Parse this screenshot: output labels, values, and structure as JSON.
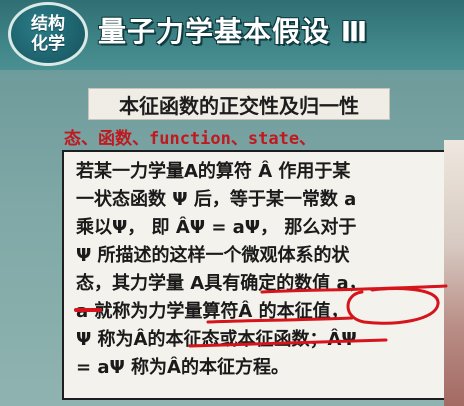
{
  "header": {
    "badge_line1": "结构",
    "badge_line2": "化学",
    "title": "量子力学基本假设 Ⅲ"
  },
  "subtitle": "本征函数的正交性及归一性",
  "annotation": "态、函数、function、state、",
  "content": {
    "line1": "若某一力学量A的算符 Â 作用于某",
    "line2": "一状态函数 Ψ 后，等于某一常数 a",
    "line3": "乘以Ψ， 即 ÂΨ = aΨ， 那么对于",
    "line4": "Ψ 所描述的这样一个微观体系的状",
    "line5": "态，其力学量 A具有确定的数值 a，",
    "line6": "a 就称为力学量算符Â 的本征值，",
    "line7": "Ψ 称为Â的本征态或本征函数；ÂΨ",
    "line8": "= aΨ 称为Â的本征方程。"
  },
  "colors": {
    "header_bg": "#3a7f83",
    "annotation": "#c0191f",
    "ink": "#d6141c",
    "box_bg": "#f3f2ec"
  }
}
